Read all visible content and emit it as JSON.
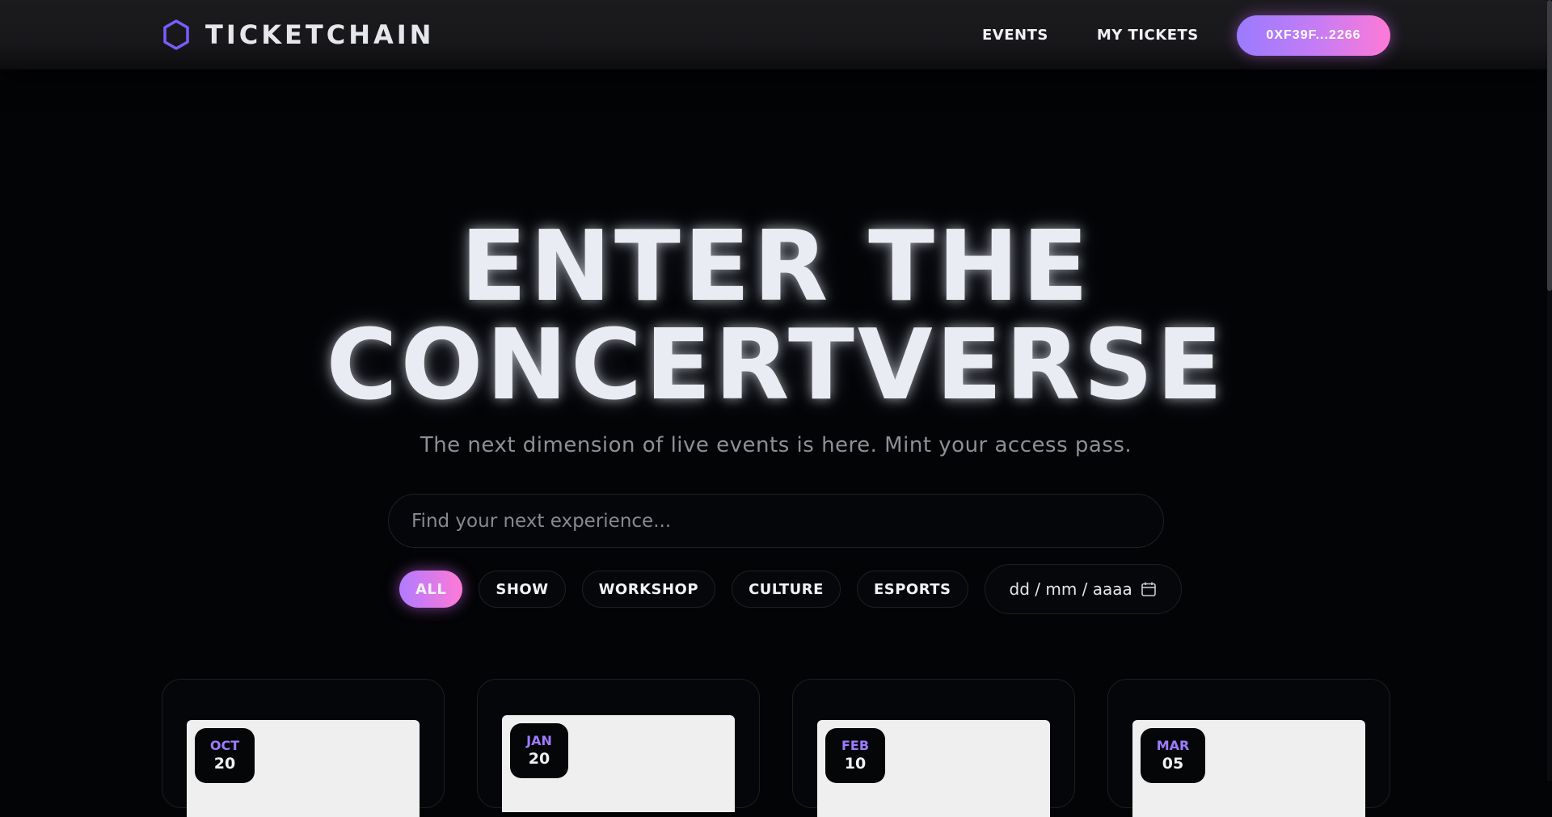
{
  "brand": {
    "name": "TICKETCHAIN",
    "icon": "hexagon-icon",
    "accent_color": "#7b5cff"
  },
  "nav": {
    "links": [
      {
        "label": "EVENTS"
      },
      {
        "label": "MY TICKETS"
      }
    ],
    "wallet_label": "0XF39F...2266"
  },
  "hero": {
    "title_line1": "ENTER THE",
    "title_line2": "CONCERTVERSE",
    "subtitle": "The next dimension of live events is here. Mint your access pass."
  },
  "search": {
    "placeholder": "Find your next experience...",
    "value": ""
  },
  "filters": {
    "categories": [
      {
        "label": "ALL",
        "active": true
      },
      {
        "label": "SHOW",
        "active": false
      },
      {
        "label": "WORKSHOP",
        "active": false
      },
      {
        "label": "CULTURE",
        "active": false
      },
      {
        "label": "ESPORTS",
        "active": false
      }
    ],
    "date_placeholder": "dd / mm / aaaa"
  },
  "events": [
    {
      "month": "OCT",
      "day": "20"
    },
    {
      "month": "JAN",
      "day": "20"
    },
    {
      "month": "FEB",
      "day": "10"
    },
    {
      "month": "MAR",
      "day": "05"
    }
  ]
}
